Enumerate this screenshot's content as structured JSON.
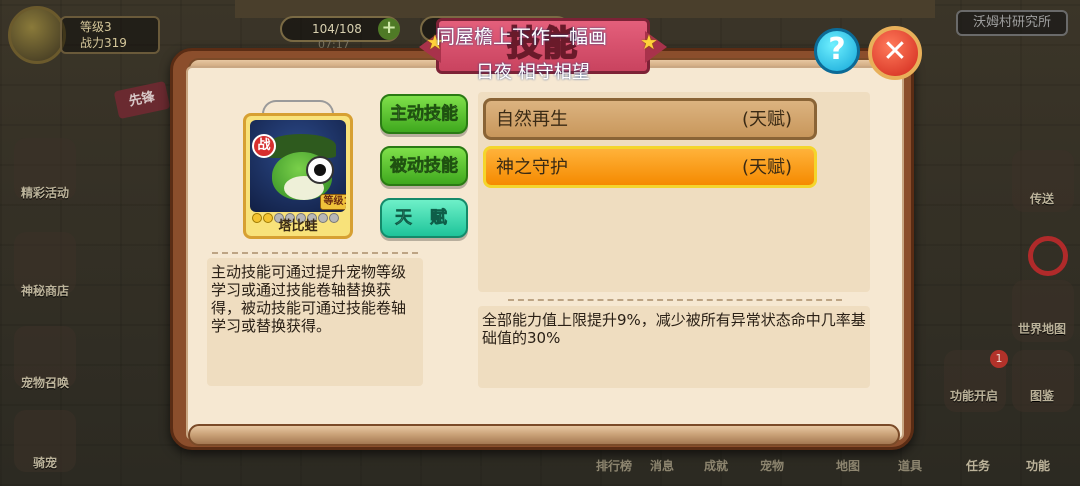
{
  "background": {
    "player_level": "等级3",
    "player_power": "战力319",
    "stamina": "104/108",
    "stamina_sub": "07:17",
    "location_button": "沃姆村研究所",
    "vanguard_tag": "先锋",
    "left_menu": [
      "精彩活动",
      "神秘商店",
      "宠物召唤",
      "骑宠"
    ],
    "right_menu": [
      "传送",
      "世界地图",
      "功能开启",
      "图鉴"
    ],
    "bottom_tabs": [
      "排行榜",
      "消息",
      "成就",
      "宠物",
      "地图",
      "道具",
      "任务",
      "功能"
    ],
    "notification_count": "1"
  },
  "dialog": {
    "title": "技能",
    "overlay_top": "同屋檐上下作一幅画",
    "overlay_sub": "日夜 相守相望",
    "help_icon": "question-icon",
    "close_icon": "close-x-icon",
    "pet": {
      "name": "塔比蛙",
      "role_badge": "战",
      "level_tag": "等级1",
      "star_count": 2,
      "max_stars": 8
    },
    "tabs": [
      "主动技能",
      "被动技能",
      "天赋"
    ],
    "selected_tab": "天赋",
    "skills": [
      {
        "name": "自然再生",
        "tag": "(天赋)",
        "selected": false
      },
      {
        "name": "神之守护",
        "tag": "(天赋)",
        "selected": true
      }
    ],
    "left_description": "主动技能可通过提升宠物等级学习或通过技能卷轴替换获得，被动技能可通过技能卷轴学习或替换获得。",
    "skill_description": "全部能力值上限提升9%，减少被所有异常状态命中几率基础值的30%"
  },
  "colors": {
    "dialog_frame": "#8b4e2c",
    "parchment": "#f6e8d2",
    "selected_skill": "#f58a00",
    "tab_green": "#3fa81e",
    "tab_teal": "#1ec49a",
    "title_banner": "#c9435f"
  }
}
